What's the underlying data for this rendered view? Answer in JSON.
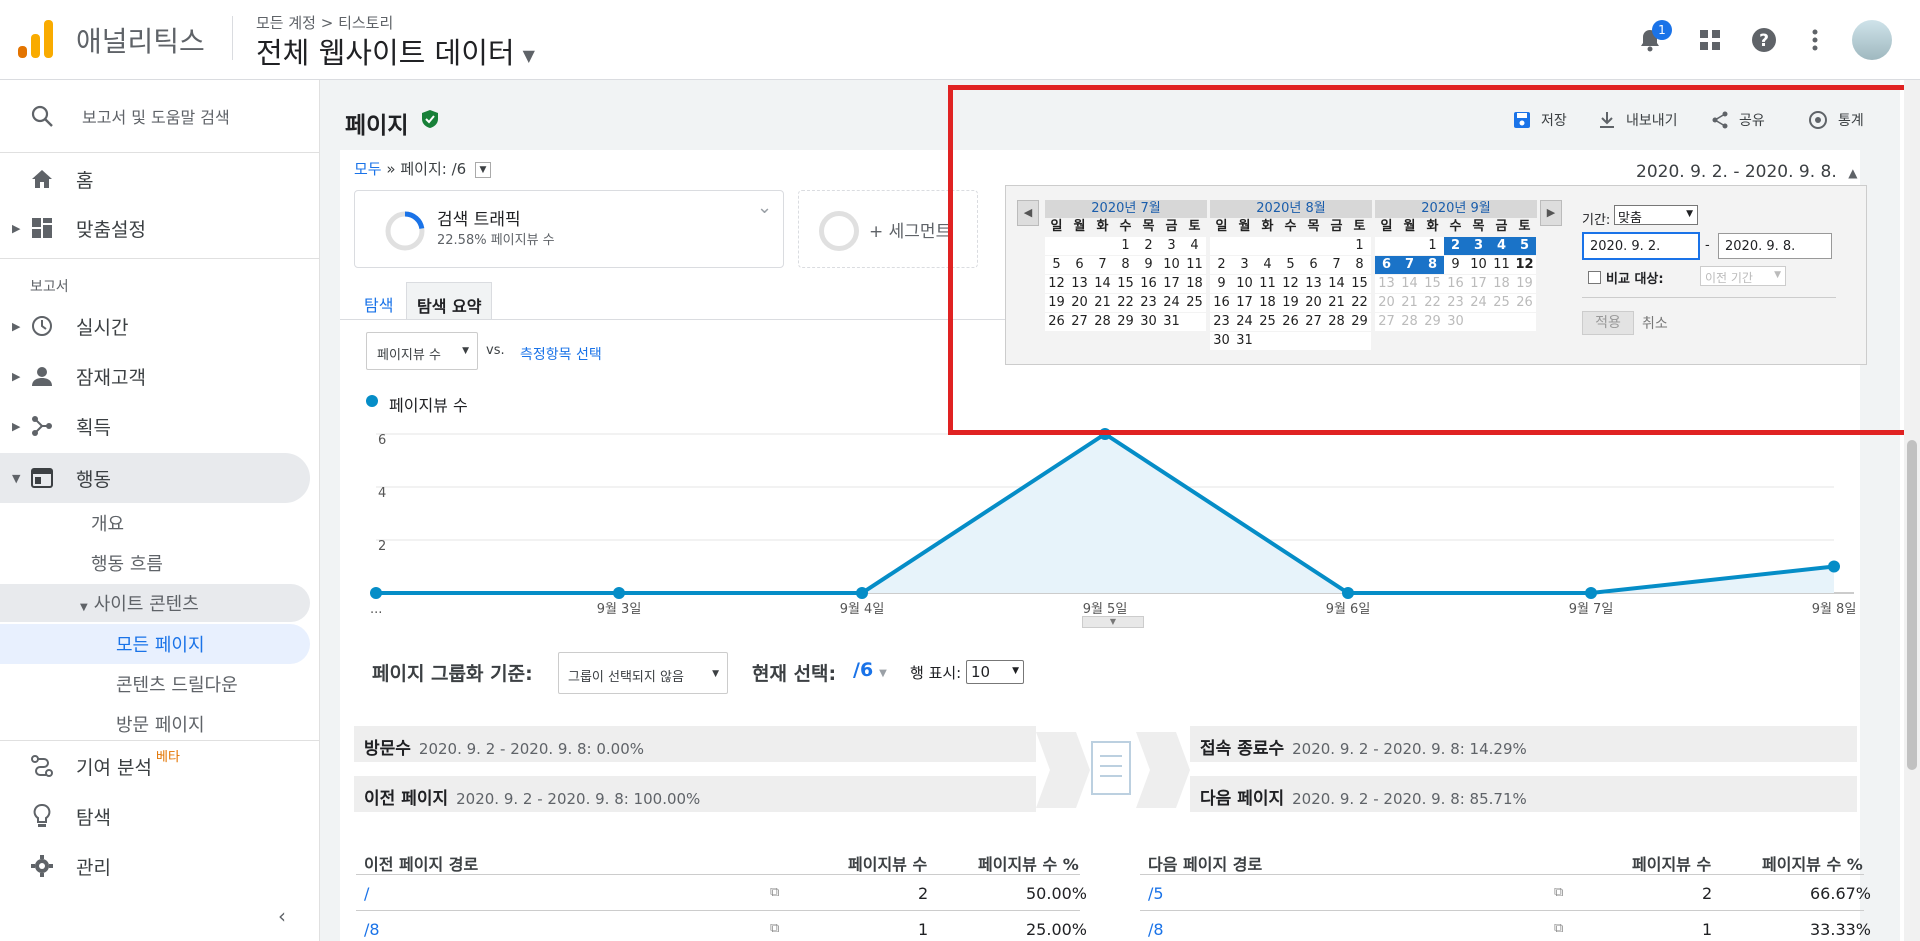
{
  "app": {
    "name": "애널리틱스",
    "breadcrumb": "모든 계정 > 티스토리",
    "property": "전체 웹사이트 데이터",
    "notification_count": "1"
  },
  "sidebar": {
    "search_placeholder": "보고서 및 도움말 검색",
    "home": "홈",
    "customization": "맞춤설정",
    "reports_label": "보고서",
    "realtime": "실시간",
    "audience": "잠재고객",
    "acquisition": "획득",
    "behavior": "행동",
    "behavior_sub": [
      "개요",
      "행동 흐름"
    ],
    "site_content": "사이트 콘텐츠",
    "site_content_sub": [
      "모든 페이지",
      "콘텐츠 드릴다운",
      "방문 페이지"
    ],
    "attribution": "기여 분석",
    "attribution_badge": "베타",
    "discover": "탐색",
    "admin": "관리"
  },
  "page": {
    "title": "페이지",
    "scope_all": "모두",
    "scope_sep": "»",
    "scope_page": "페이지: /6",
    "date_range": "2020. 9. 2. - 2020. 9. 8."
  },
  "actions": {
    "save": "저장",
    "export": "내보내기",
    "share": "공유",
    "insights": "통계"
  },
  "segments": {
    "seg1_title": "검색 트래픽",
    "seg1_sub": "22.58% 페이지뷰 수",
    "seg1_pct": 22.58,
    "add_segment": "+ 세그먼트"
  },
  "tabs": {
    "explorer": "탐색",
    "summary": "탐색 요약"
  },
  "metric": {
    "selected": "페이지뷰 수",
    "vs": "vs.",
    "compare_link": "측정항목 선택",
    "legend": "페이지뷰 수"
  },
  "chart_data": {
    "type": "line",
    "x": [
      "...",
      "9월 3일",
      "9월 4일",
      "9월 5일",
      "9월 6일",
      "9월 7일",
      "9월 8일"
    ],
    "series": [
      {
        "name": "페이지뷰 수",
        "values": [
          0,
          0,
          0,
          6,
          0,
          0,
          1
        ]
      }
    ],
    "y_ticks": [
      "6",
      "4",
      "2"
    ],
    "ylim": [
      0,
      6
    ],
    "color": "#058dc7"
  },
  "grouping": {
    "label": "페이지 그룹화 기준:",
    "select": "그룹이 선택되지 않음",
    "current_label": "현재 선택:",
    "current_value": "/6",
    "rows_label": "행 표시:",
    "rows_value": "10"
  },
  "flow": {
    "entrances_title": "방문수",
    "entrances_stat": "2020. 9. 2 - 2020. 9. 8: 0.00%",
    "prev_title": "이전 페이지",
    "prev_stat": "2020. 9. 2 - 2020. 9. 8: 100.00%",
    "exits_title": "접속 종료수",
    "exits_stat": "2020. 9. 2 - 2020. 9. 8: 14.29%",
    "next_title": "다음 페이지",
    "next_stat": "2020. 9. 2 - 2020. 9. 8: 85.71%"
  },
  "prev_table": {
    "headers": [
      "이전 페이지 경로",
      "페이지뷰 수",
      "페이지뷰 수 %"
    ],
    "rows": [
      [
        "/",
        "2",
        "50.00%"
      ],
      [
        "/8",
        "1",
        "25.00%"
      ]
    ]
  },
  "next_table": {
    "headers": [
      "다음 페이지 경로",
      "페이지뷰 수",
      "페이지뷰 수 %"
    ],
    "rows": [
      [
        "/5",
        "2",
        "66.67%"
      ],
      [
        "/8",
        "1",
        "33.33%"
      ]
    ]
  },
  "datepicker": {
    "months": [
      "2020년 7월",
      "2020년 8월",
      "2020년 9월"
    ],
    "weekdays": [
      "일",
      "월",
      "화",
      "수",
      "목",
      "금",
      "토"
    ],
    "range_label": "기간:",
    "range_option": "맞춤",
    "start": "2020. 9. 2.",
    "end": "2020. 9. 8.",
    "compare_label": "비교 대상:",
    "compare_option": "이전 기간",
    "apply": "적용",
    "cancel": "취소"
  }
}
